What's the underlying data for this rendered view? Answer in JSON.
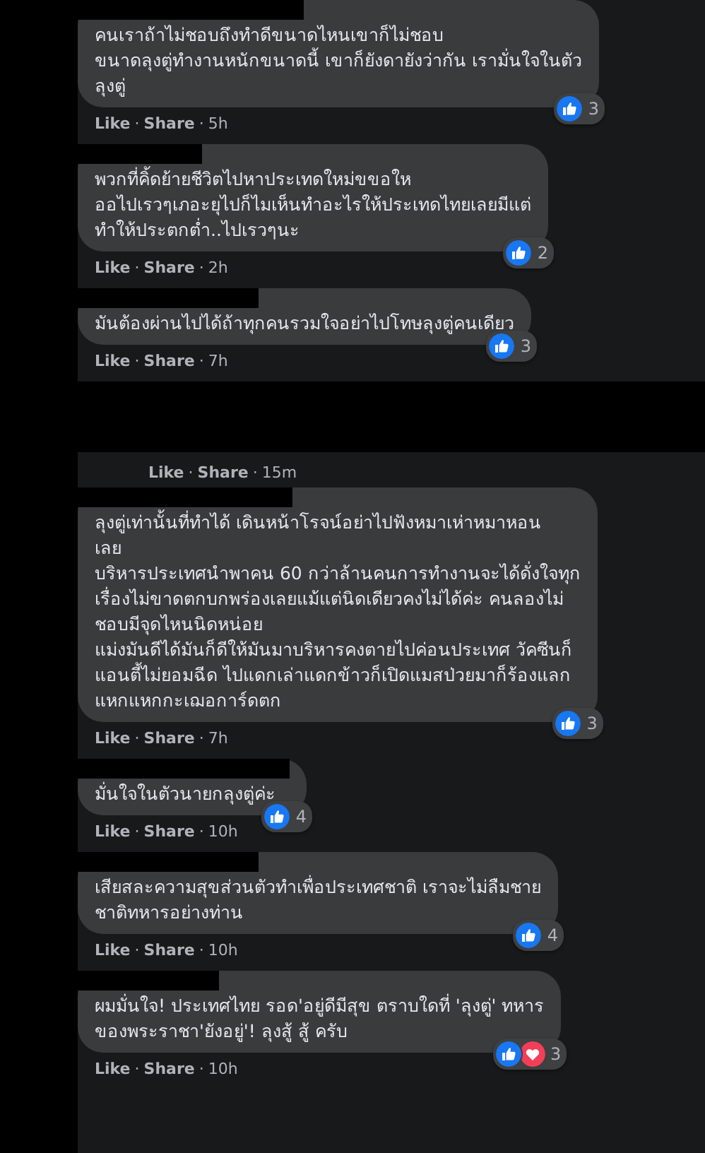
{
  "sections": [
    {
      "comments": [
        {
          "lines": [
            "คนเราถ้าไม่ชอบถึงทำดีขนาดไหนเขาก็ไม่ชอบ",
            "ขนาดลุงตู่ทำงานหนักขนาดนี้ เขาก็ยังดายังว่ากัน เรามั่นใจในตัว",
            "ลุงตู่"
          ],
          "reactions": [
            {
              "kind": "like"
            }
          ],
          "count": "3",
          "actions": [
            "Like",
            "·",
            "Share",
            "·",
            "5h"
          ]
        },
        {
          "lines": [
            "พวกที่คิ้ดย้ายชีวิตไปหาประเทดใหม่ขขอให",
            "ออไปเรวๆเภอะยุไปก็ไมเห็นทำอะไรให้ประเทดไทยเลยมีแต่",
            "ทำให้ประตกต่ำ..ไปเรวๆนะ"
          ],
          "reactions": [
            {
              "kind": "like"
            }
          ],
          "count": "2",
          "actions": [
            "Like",
            "·",
            "Share",
            "·",
            "2h"
          ]
        },
        {
          "lines": [
            "มันต้องผ่านไปได้ถ้าทุกคนรวมใจอย่าไปโทษลุงตู่คนเดียว"
          ],
          "reactions": [
            {
              "kind": "like"
            }
          ],
          "count": "3",
          "actions": [
            "Like",
            "·",
            "Share",
            "·",
            "7h"
          ]
        }
      ]
    },
    {
      "top_meta": [
        "Like",
        "·",
        "Share",
        "·",
        "15m"
      ],
      "comments": [
        {
          "lines": [
            "ลุงตู่เท่านั้นที่ทำได้ เดินหน้าโรจน์อย่าไปฟังหมาเห่าหมาหอน",
            "เลย",
            "บริหารประเทศนำพาคน 60 กว่าล้านคนการทำงานจะได้ดั่งใจทุก",
            "เรื่องไม่ขาดตกบกพร่องเลยแม้แต่นิดเดียวคงไม่ได้ค่ะ คนลองไม่",
            "ชอบมีจุดไหนนิดหน่อย",
            "แม่งมันดีได้มันก็ดีให้มันมาบริหารคงตายไปค่อนประเทศ วัคซีนก็",
            "แอนตี้ไม่ยอมฉีด ไปแดกเล่าแดกข้าวก็เปิดแมสป่วยมาก็ร้องแลก",
            "แหกแหกกะเฌอการ์ดตก"
          ],
          "reactions": [
            {
              "kind": "like"
            }
          ],
          "count": "3",
          "actions": [
            "Like",
            "·",
            "Share",
            "·",
            "7h"
          ]
        },
        {
          "lines": [
            "มั่นใจในตัวนายกลุงตู่ค่ะ"
          ],
          "reactions": [
            {
              "kind": "like"
            }
          ],
          "count": "4",
          "actions": [
            "Like",
            "·",
            "Share",
            "·",
            "10h"
          ]
        },
        {
          "lines": [
            "เสียสละความสุขส่วนตัวทำเพื่อประเทศชาติ เราจะไม่ลืมชาย",
            "ชาติทหารอย่างท่าน"
          ],
          "reactions": [
            {
              "kind": "like"
            }
          ],
          "count": "4",
          "actions": [
            "Like",
            "·",
            "Share",
            "·",
            "10h"
          ]
        },
        {
          "lines": [
            "ผมมั่นใจ! ประเทศไทย รอด'อยู่ดีมีสุข ตราบใดที่ 'ลุงตู่' ทหาร",
            "ของพระราชา'ยังอยู่'! ลุงสู้ สู้ ครับ"
          ],
          "reactions": [
            {
              "kind": "like"
            },
            {
              "kind": "love"
            }
          ],
          "count": "3",
          "actions": [
            "Like",
            "·",
            "Share",
            "·",
            "10h"
          ]
        }
      ]
    }
  ]
}
